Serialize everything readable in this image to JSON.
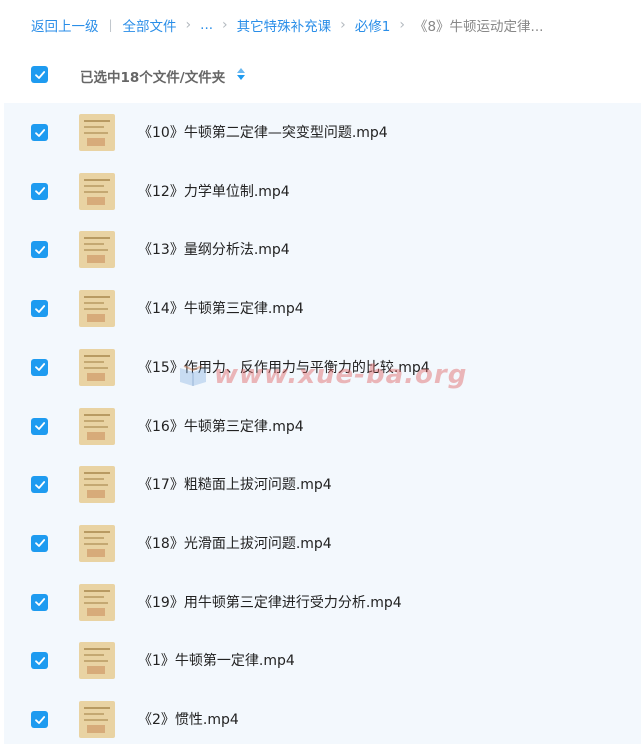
{
  "breadcrumb": {
    "back": "返回上一级",
    "separator": "|",
    "all_files": "全部文件",
    "ellipsis": "...",
    "folder1": "其它特殊补充课",
    "folder2": "必修1",
    "current": "《8》牛顿运动定律...",
    "arrow": "›"
  },
  "selection": {
    "text": "已选中18个文件/文件夹"
  },
  "files": [
    {
      "name": "《10》牛顿第二定律—突变型问题.mp4"
    },
    {
      "name": "《12》力学单位制.mp4"
    },
    {
      "name": "《13》量纲分析法.mp4"
    },
    {
      "name": "《14》牛顿第三定律.mp4"
    },
    {
      "name": "《15》作用力、反作用力与平衡力的比较.mp4"
    },
    {
      "name": "《16》牛顿第三定律.mp4"
    },
    {
      "name": "《17》粗糙面上拔河问题.mp4"
    },
    {
      "name": "《18》光滑面上拔河问题.mp4"
    },
    {
      "name": "《19》用牛顿第三定律进行受力分析.mp4"
    },
    {
      "name": "《1》牛顿第一定律.mp4"
    },
    {
      "name": "《2》惯性.mp4"
    }
  ],
  "watermark": {
    "text": "www.xue-ba.org"
  },
  "colors": {
    "accent": "#1e9bf0",
    "link": "#2a8ee8",
    "list_bg": "#f3f8fd",
    "thumb": "#e9d3a3"
  }
}
